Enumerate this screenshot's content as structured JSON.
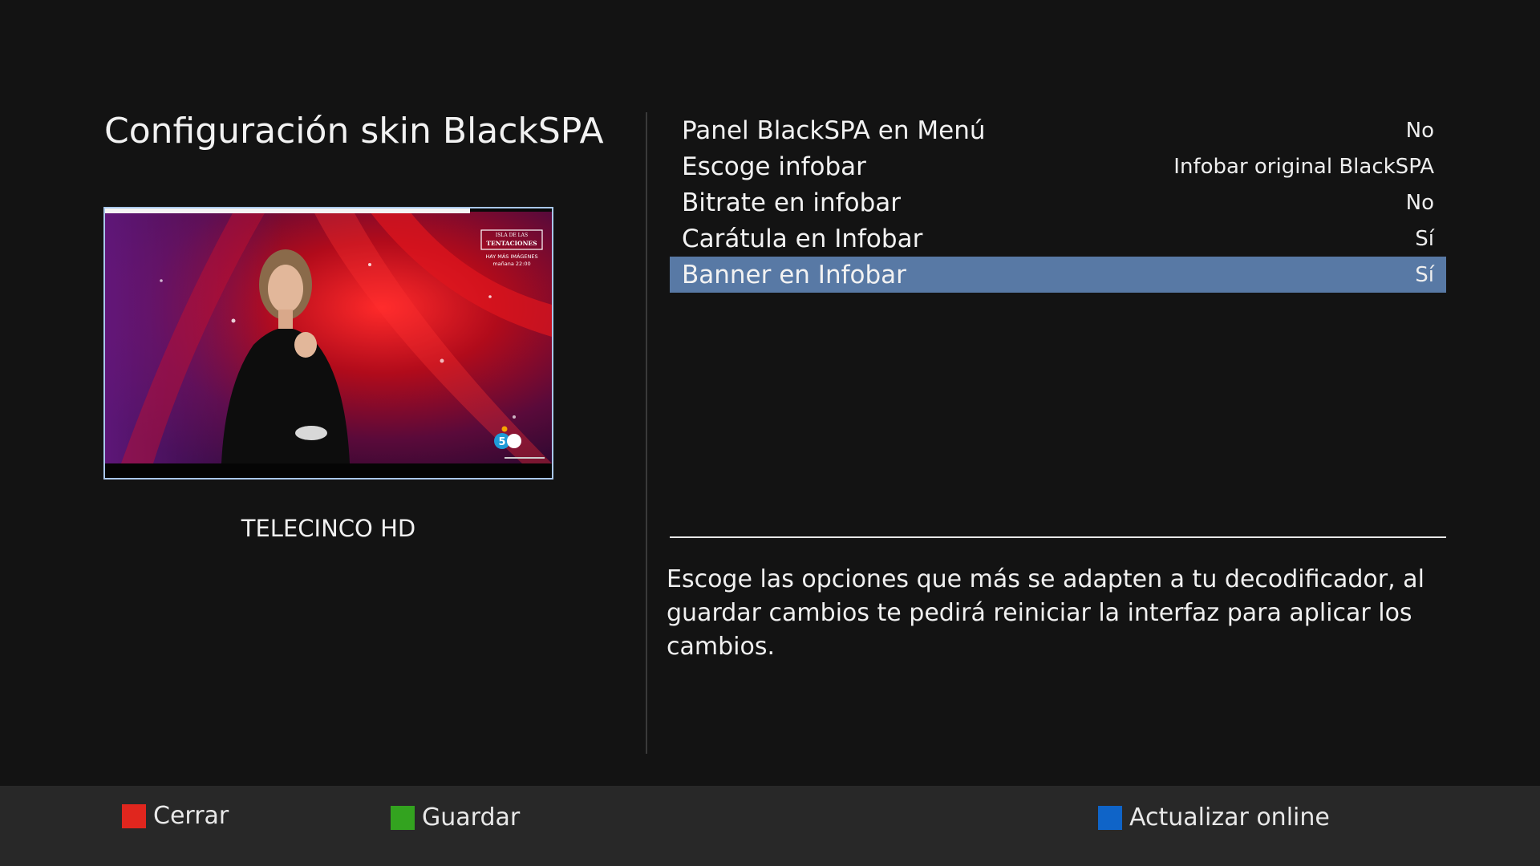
{
  "header": {
    "title": "Configuración skin BlackSPA"
  },
  "preview": {
    "channel_name": "TELECINCO HD",
    "overlay_line1": "ISLA DE LAS",
    "overlay_line2": "TENTACIONES",
    "overlay_line3": "HAY MÁS IMÁGENES",
    "overlay_line4": "mañana 22:00",
    "channel_logo": "5"
  },
  "settings": {
    "items": [
      {
        "label": "Panel BlackSPA en Menú",
        "value": "No",
        "selected": false
      },
      {
        "label": "Escoge infobar",
        "value": "Infobar original BlackSPA",
        "selected": false
      },
      {
        "label": "Bitrate en infobar",
        "value": "No",
        "selected": false
      },
      {
        "label": "Carátula en Infobar",
        "value": "Sí",
        "selected": false
      },
      {
        "label": "Banner en Infobar",
        "value": "Sí",
        "selected": true
      }
    ]
  },
  "description": "Escoge las opciones que más se adapten a tu decodificador, al guardar cambios te pedirá reiniciar la interfaz para aplicar los cambios.",
  "footer": {
    "red": {
      "label": "Cerrar",
      "color": "#e0261e"
    },
    "green": {
      "label": "Guardar",
      "color": "#33a31f"
    },
    "blue": {
      "label": "Actualizar online",
      "color": "#0f64c8"
    }
  },
  "colors": {
    "background": "#131313",
    "selection": "#5879a5",
    "footer_bg": "#282828",
    "preview_border": "#a9c7ea"
  }
}
